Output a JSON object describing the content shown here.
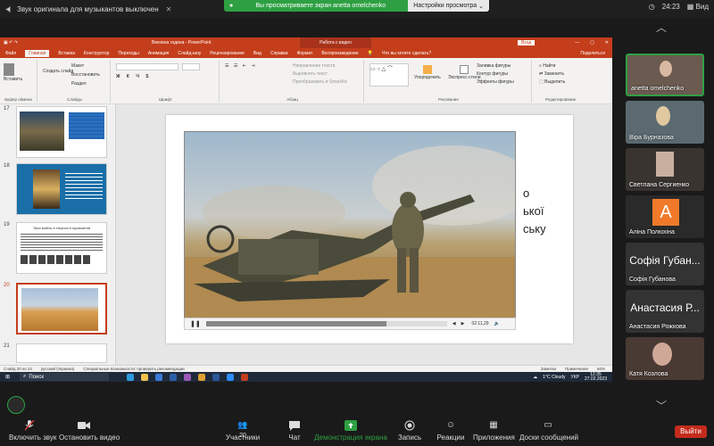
{
  "zoom_top": {
    "notice": "Звук оригинала для музыкантов выключен",
    "share_message": "Вы просматриваете экран anetta omelchenko",
    "view_options": "Настройки просмотра",
    "time": "24:23",
    "view_label": "Вид"
  },
  "ppt": {
    "window_title": "Вековна година - PowerPoint",
    "context_tab": "Работа с видео",
    "login": "Вход",
    "tabs": [
      "Файл",
      "Главная",
      "Вставка",
      "Конструктор",
      "Переходы",
      "Анимация",
      "Слайд-шоу",
      "Рецензирование",
      "Вид",
      "Справка",
      "Формат",
      "Воспроизведение"
    ],
    "active_tab": "Главная",
    "search_hint": "Что вы хотите сделать?",
    "share": "Поделиться",
    "ribbon": {
      "paste": "Вставить",
      "clipboard": "Буфер обмена",
      "new_slide": "Создать слайд",
      "layout": "Макет",
      "reset": "Восстановить",
      "section": "Раздел",
      "slides": "Слайды",
      "font": "Шрифт",
      "paragraph": "Абзац",
      "text_direction": "Направление текста",
      "align_text": "Выровнять текст",
      "convert_smartart": "Преобразовать в SmartArt",
      "arrange": "Упорядочить",
      "quick_styles": "Экспресс-стили",
      "drawing": "Рисование",
      "shape_fill": "Заливка фигуры",
      "shape_outline": "Контур фигуры",
      "shape_effects": "Эффекты фигуры",
      "find": "Найти",
      "replace": "Заменить",
      "select": "Выделить",
      "editing": "Редактирование"
    },
    "thumb_numbers": [
      "17",
      "18",
      "19",
      "20",
      "21"
    ],
    "thumb19_title": "Твои войны в творчості музикантів",
    "slide_text_lines": [
      "о",
      "ької",
      "",
      "ську"
    ],
    "video_time": "02:11,29",
    "status": {
      "slide_count": "Слайд 20 из 24",
      "language": "русский (Украина)",
      "accessibility": "Специальные возможности: проверить рекомендации",
      "notes": "Заметки",
      "comments": "Примечания",
      "zoom": "60%"
    }
  },
  "taskbar": {
    "search": "Поиск",
    "weather": "1°C Cloudy",
    "lang": "УКР",
    "time": "12:35",
    "date": "27.02.2023"
  },
  "participants": [
    {
      "name": "anetta omelchenko",
      "big": ""
    },
    {
      "name": "Віра Бурназова",
      "big": ""
    },
    {
      "name": "Светлана Сергиенко",
      "big": ""
    },
    {
      "name": "Аліна Полюхіна",
      "big": "А"
    },
    {
      "name": "Софія Губанова",
      "big": "Софія Губан..."
    },
    {
      "name": "Анастасия Рожкова",
      "big": "Анастасия Р..."
    },
    {
      "name": "Катя Козлова",
      "big": ""
    }
  ],
  "bottom": {
    "audio": "Включить звук",
    "video": "Остановить видео",
    "participants": "Участники",
    "participants_count": "20",
    "chat": "Чат",
    "share": "Демонстрация экрана",
    "record": "Запись",
    "reactions": "Реакции",
    "apps": "Приложения",
    "whiteboards": "Доски сообщений",
    "exit": "Выйти"
  }
}
